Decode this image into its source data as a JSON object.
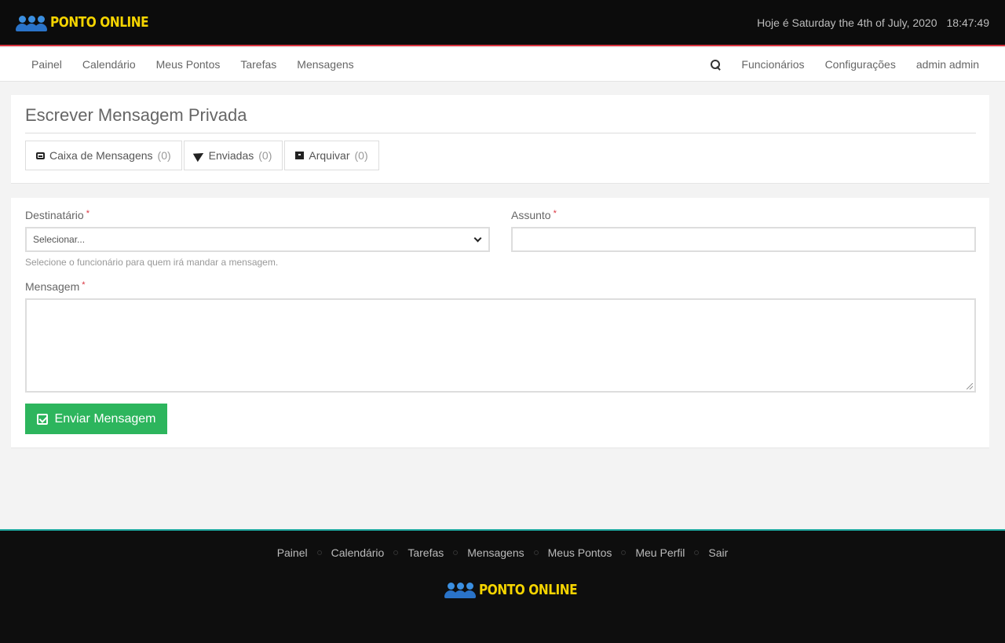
{
  "header": {
    "logo_text": "PONTO ONLINE",
    "date_text": "Hoje é Saturday the 4th of July, 2020",
    "time_text": "18:47:49"
  },
  "nav": {
    "left": [
      "Painel",
      "Calendário",
      "Meus Pontos",
      "Tarefas",
      "Mensagens"
    ],
    "right": [
      "Funcionários",
      "Configurações",
      "admin admin"
    ]
  },
  "page": {
    "title": "Escrever Mensagem Privada",
    "tabs": [
      {
        "label": "Caixa de Mensagens",
        "count": "(0)",
        "icon": "inbox-icon"
      },
      {
        "label": "Enviadas",
        "count": "(0)",
        "icon": "send-icon"
      },
      {
        "label": "Arquivar",
        "count": "(0)",
        "icon": "archive-icon"
      }
    ]
  },
  "form": {
    "recipient_label": "Destinatário",
    "recipient_value": "Selecionar...",
    "recipient_help": "Selecione o funcionário para quem irá mandar a mensagem.",
    "subject_label": "Assunto",
    "message_label": "Mensagem",
    "required_mark": "*",
    "submit_label": "Enviar Mensagem"
  },
  "footer": {
    "links": [
      "Painel",
      "Calendário",
      "Tarefas",
      "Mensagens",
      "Meus Pontos",
      "Meu Perfil",
      "Sair"
    ],
    "logo_text": "PONTO ONLINE"
  },
  "colors": {
    "accent_red": "#d9333f",
    "button_green": "#2db55d",
    "logo_yellow": "#f5d400",
    "footer_border": "#1fa8a0"
  }
}
